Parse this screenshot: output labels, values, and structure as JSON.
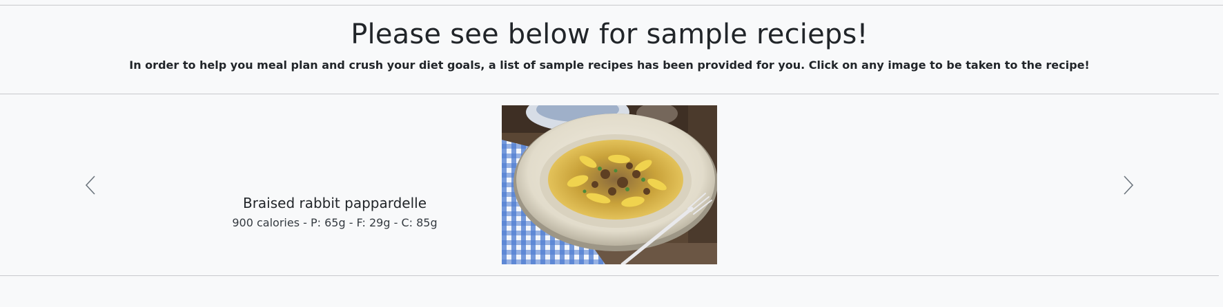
{
  "header": {
    "title": "Please see below for sample recieps!",
    "subtitle": "In order to help you meal plan and crush your diet goals, a list of sample recipes has been provided for you. Click on any image to be taken to the recipe!"
  },
  "carousel": {
    "prev_icon": "chevron-left-icon",
    "next_icon": "chevron-right-icon",
    "active_slide": {
      "name": "Braised rabbit pappardelle",
      "macros": "900 calories - P: 65g - F: 29g - C: 85g",
      "image_alt": "Braised rabbit pappardelle"
    }
  },
  "colors": {
    "background": "#f8f9fa",
    "text": "#212529",
    "divider": "#c8c9cc",
    "arrow": "#6c757d"
  }
}
